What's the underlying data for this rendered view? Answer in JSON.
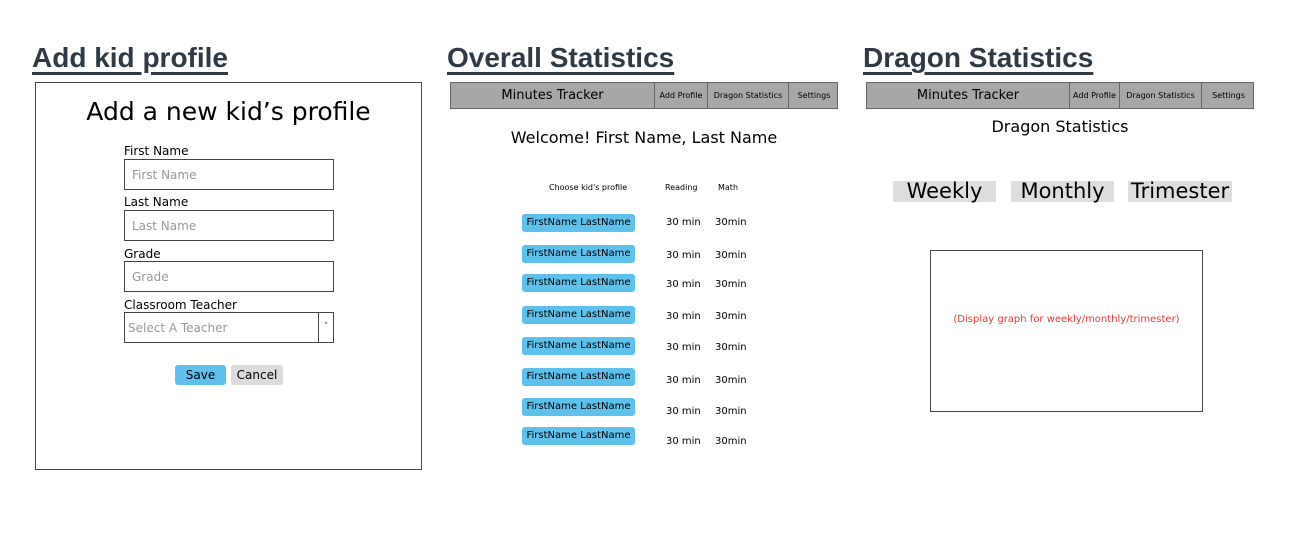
{
  "titles": {
    "add_kid": "Add kid profile",
    "overall": "Overall Statistics",
    "dragon": "Dragon Statistics"
  },
  "add_form": {
    "heading": "Add a new kid’s profile",
    "first_name": {
      "label": "First Name",
      "placeholder": "First Name"
    },
    "last_name": {
      "label": "Last Name",
      "placeholder": "Last Name"
    },
    "grade": {
      "label": "Grade",
      "placeholder": "Grade"
    },
    "teacher": {
      "label": "Classroom Teacher",
      "placeholder": "Select A Teacher",
      "arrow": "˅"
    },
    "save_label": "Save",
    "cancel_label": "Cancel"
  },
  "nav": {
    "brand": "Minutes Tracker",
    "add_profile": "Add Profile",
    "dragon_stats": "Dragon Statistics",
    "settings": "Settings"
  },
  "overall": {
    "welcome": "Welcome! First Name, Last Name",
    "col_profile": "Choose kid's profile",
    "col_reading": "Reading",
    "col_math": "Math",
    "rows": [
      {
        "name": "FirstName LastName",
        "reading": "30 min",
        "math": "30min"
      },
      {
        "name": "FirstName LastName",
        "reading": "30 min",
        "math": "30min"
      },
      {
        "name": "FirstName LastName",
        "reading": "30 min",
        "math": "30min"
      },
      {
        "name": "FirstName LastName",
        "reading": "30 min",
        "math": "30min"
      },
      {
        "name": "FirstName LastName",
        "reading": "30 min",
        "math": "30min"
      },
      {
        "name": "FirstName LastName",
        "reading": "30 min",
        "math": "30min"
      },
      {
        "name": "FirstName LastName",
        "reading": "30 min",
        "math": "30min"
      },
      {
        "name": "FirstName LastName",
        "reading": "30 min",
        "math": "30min"
      }
    ]
  },
  "dragon": {
    "heading": "Dragon Statistics",
    "tabs": [
      "Weekly",
      "Monthly",
      "Trimester"
    ],
    "graph_placeholder": "(Display graph for weekly/monthly/trimester)"
  },
  "colors": {
    "accent_button": "#5ec1ec",
    "nav_bg": "#a7a7a7",
    "title_color": "#2f3a44",
    "graph_text": "#e23b3b"
  }
}
